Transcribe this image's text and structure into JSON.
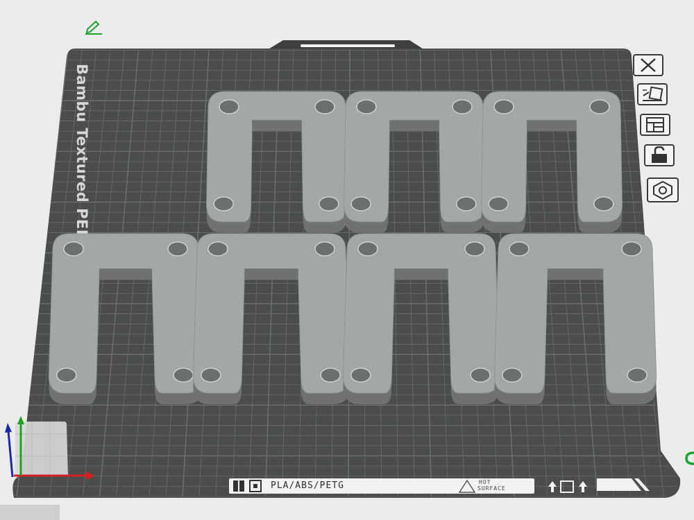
{
  "plate": {
    "name": "Bambu Textured PEI Pla",
    "filament_types": "PLA/ABS/PETG",
    "hot_surface": [
      "HOT",
      "SURFACE"
    ]
  },
  "toolbar": [
    {
      "name": "close-view",
      "icon": "close-x-icon"
    },
    {
      "name": "auto-orient",
      "icon": "auto-orient-icon"
    },
    {
      "name": "arrange",
      "icon": "arrange-icon"
    },
    {
      "name": "lock-plate",
      "icon": "lock-icon"
    },
    {
      "name": "plate-settings",
      "icon": "hexagon-nut-icon"
    }
  ],
  "parts_count": 7,
  "colors": {
    "bed": "#4a4d4c",
    "grid": "#6a6d6c",
    "part_top": "#a4a7a8",
    "part_side": "#6f7172",
    "axis_x": "#d62020",
    "axis_y": "#20a020",
    "axis_z": "#1a2aa8",
    "accent": "#1aa531"
  }
}
